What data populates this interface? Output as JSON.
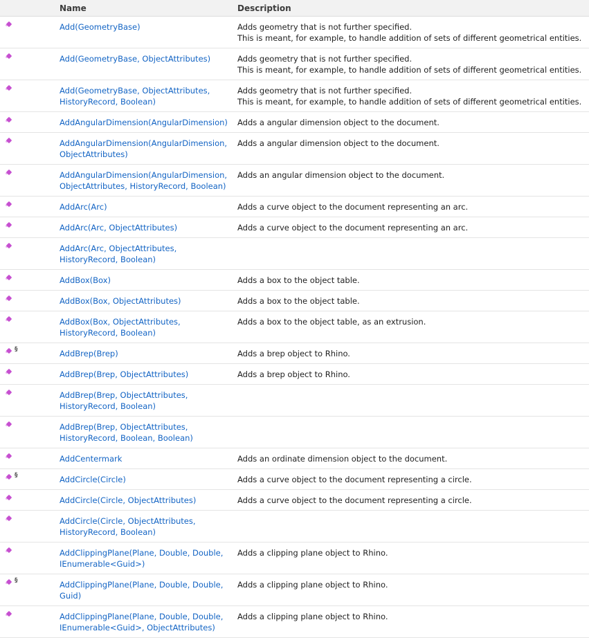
{
  "header": {
    "name": "Name",
    "description": "Description"
  },
  "rows": [
    {
      "name": "Add(GeometryBase)",
      "desc": [
        "Adds geometry that is not further specified.",
        "This is meant, for example, to handle addition of sets of different geometrical entities."
      ],
      "static": false
    },
    {
      "name": "Add(GeometryBase, ObjectAttributes)",
      "desc": [
        "Adds geometry that is not further specified.",
        "This is meant, for example, to handle addition of sets of different geometrical entities."
      ],
      "static": false
    },
    {
      "name": "Add(GeometryBase, ObjectAttributes, HistoryRecord, Boolean)",
      "desc": [
        "Adds geometry that is not further specified.",
        "This is meant, for example, to handle addition of sets of different geometrical entities."
      ],
      "static": false
    },
    {
      "name": "AddAngularDimension(AngularDimension)",
      "desc": [
        "Adds a angular dimension object to the document."
      ],
      "static": false
    },
    {
      "name": "AddAngularDimension(AngularDimension, ObjectAttributes)",
      "desc": [
        "Adds a angular dimension object to the document."
      ],
      "static": false
    },
    {
      "name": "AddAngularDimension(AngularDimension, ObjectAttributes, HistoryRecord, Boolean)",
      "desc": [
        "Adds an angular dimension object to the document."
      ],
      "static": false
    },
    {
      "name": "AddArc(Arc)",
      "desc": [
        "Adds a curve object to the document representing an arc."
      ],
      "static": false
    },
    {
      "name": "AddArc(Arc, ObjectAttributes)",
      "desc": [
        "Adds a curve object to the document representing an arc."
      ],
      "static": false
    },
    {
      "name": "AddArc(Arc, ObjectAttributes, HistoryRecord, Boolean)",
      "desc": [],
      "static": false
    },
    {
      "name": "AddBox(Box)",
      "desc": [
        "Adds a box to the object table."
      ],
      "static": false
    },
    {
      "name": "AddBox(Box, ObjectAttributes)",
      "desc": [
        "Adds a box to the object table."
      ],
      "static": false
    },
    {
      "name": "AddBox(Box, ObjectAttributes, HistoryRecord, Boolean)",
      "desc": [
        "Adds a box to the object table, as an extrusion."
      ],
      "static": false
    },
    {
      "name": "AddBrep(Brep)",
      "desc": [
        "Adds a brep object to Rhino."
      ],
      "static": true
    },
    {
      "name": "AddBrep(Brep, ObjectAttributes)",
      "desc": [
        "Adds a brep object to Rhino."
      ],
      "static": false
    },
    {
      "name": "AddBrep(Brep, ObjectAttributes, HistoryRecord, Boolean)",
      "desc": [],
      "static": false
    },
    {
      "name": "AddBrep(Brep, ObjectAttributes, HistoryRecord, Boolean, Boolean)",
      "desc": [],
      "static": false
    },
    {
      "name": "AddCentermark",
      "desc": [
        "Adds an ordinate dimension object to the document."
      ],
      "static": false
    },
    {
      "name": "AddCircle(Circle)",
      "desc": [
        "Adds a curve object to the document representing a circle."
      ],
      "static": true
    },
    {
      "name": "AddCircle(Circle, ObjectAttributes)",
      "desc": [
        "Adds a curve object to the document representing a circle."
      ],
      "static": false
    },
    {
      "name": "AddCircle(Circle, ObjectAttributes, HistoryRecord, Boolean)",
      "desc": [],
      "static": false
    },
    {
      "name": "AddClippingPlane(Plane, Double, Double, IEnumerable<Guid>)",
      "desc": [
        "Adds a clipping plane object to Rhino."
      ],
      "static": false
    },
    {
      "name": "AddClippingPlane(Plane, Double, Double, Guid)",
      "desc": [
        "Adds a clipping plane object to Rhino."
      ],
      "static": true
    },
    {
      "name": "AddClippingPlane(Plane, Double, Double, IEnumerable<Guid>, ObjectAttributes)",
      "desc": [
        "Adds a clipping plane object to Rhino."
      ],
      "static": false
    }
  ]
}
